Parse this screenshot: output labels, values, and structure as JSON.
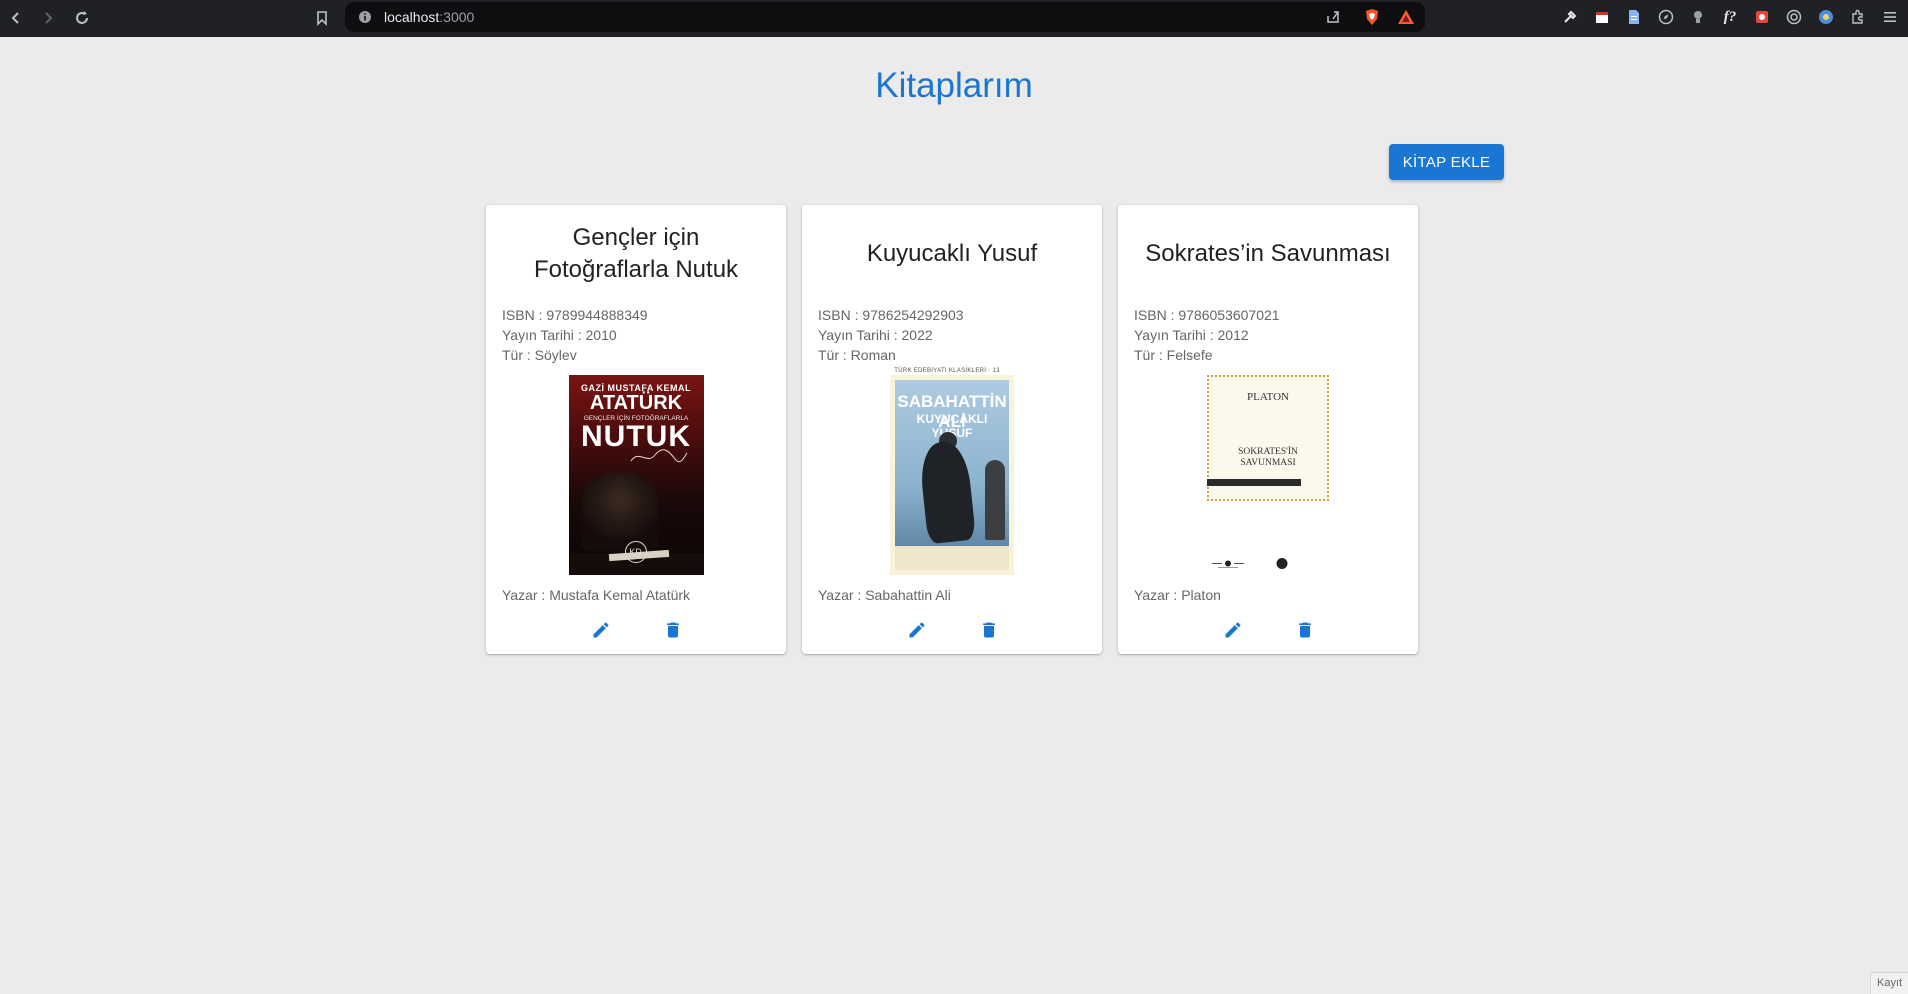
{
  "browser": {
    "url_host": "localhost",
    "url_port": ":3000"
  },
  "page": {
    "title": "Kitaplarım",
    "add_button_label": "KİTAP EKLE"
  },
  "books": [
    {
      "title": "Gençler için Fotoğraflarla Nutuk",
      "isbn": "ISBN : 9789944888349",
      "date": "Yayın Tarihi : 2010",
      "genre": "Tür : Söylev",
      "author": "Yazar : Mustafa Kemal Atatürk",
      "cover": {
        "line1": "GAZİ MUSTAFA KEMAL",
        "line2": "ATATÜRK",
        "line3": "GENÇLER İÇİN FOTOĞRAFLARLA",
        "line4": "NUTUK",
        "logo": "KD"
      }
    },
    {
      "title": "Kuyucaklı Yusuf",
      "isbn": "ISBN : 9786254292903",
      "date": "Yayın Tarihi : 2022",
      "genre": "Tür : Roman",
      "author": "Yazar : Sabahattin Ali",
      "cover": {
        "series": "TÜRK EDEBİYATI KLASİKLERİ · 13",
        "line1": "SABAHATTİN ALİ",
        "line2": "KUYUCAKLI YUSUF"
      }
    },
    {
      "title": "Sokrates’in Savunması",
      "isbn": "ISBN : 9786053607021",
      "date": "Yayın Tarihi : 2012",
      "genre": "Tür : Felsefe",
      "author": "Yazar : Platon",
      "cover": {
        "line1": "PLATON",
        "line2": "SOKRATES'İN",
        "line3": "SAVUNMASI"
      }
    }
  ],
  "status_corner": "Kayıt",
  "colors": {
    "primary": "#1976d2",
    "background": "#ebebeb",
    "chrome": "#202124"
  }
}
